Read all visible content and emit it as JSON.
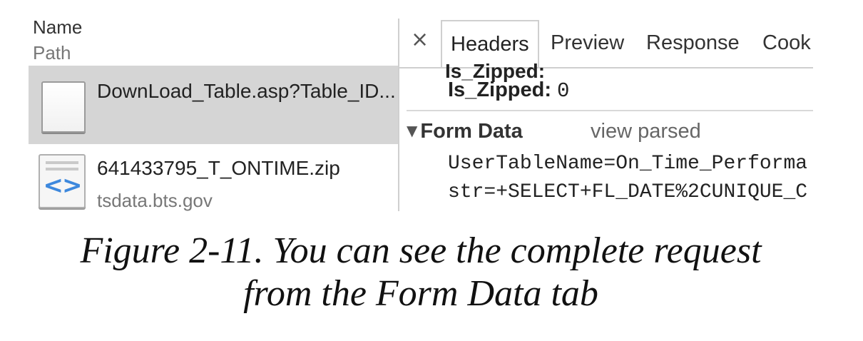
{
  "request_list": {
    "column_name": "Name",
    "column_path": "Path",
    "items": [
      {
        "name": "DownLoad_Table.asp?Table_ID...",
        "path": "",
        "icon": "document-icon",
        "selected": true
      },
      {
        "name": "641433795_T_ONTIME.zip",
        "path": "tsdata.bts.gov",
        "icon": "code-file-icon",
        "selected": false
      }
    ]
  },
  "detail": {
    "close_label": "×",
    "tabs": [
      {
        "label": "Headers",
        "active": true
      },
      {
        "label": "Preview",
        "active": false
      },
      {
        "label": "Response",
        "active": false
      },
      {
        "label": "Cook",
        "active": false
      }
    ],
    "cutoff_row": "Is_Zipped:",
    "header_row": {
      "key": "Is_Zipped:",
      "value": "0"
    },
    "form_data": {
      "toggle": "▼",
      "title": "Form Data",
      "view_parsed": "view parsed",
      "lines": [
        "UserTableName=On_Time_Performa",
        "str=+SELECT+FL_DATE%2CUNIQUE_C"
      ]
    }
  },
  "caption": {
    "line1": "Figure 2-11. You can see the complete request",
    "line2": "from the Form Data tab"
  }
}
